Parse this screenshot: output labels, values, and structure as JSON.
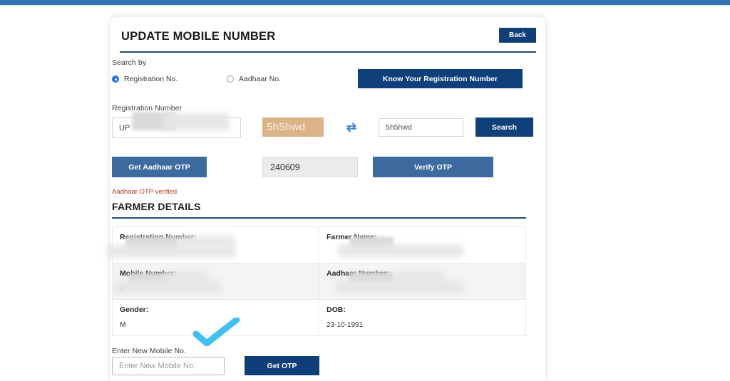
{
  "theme": {
    "accent_bar": "#3273b8",
    "primary_dark": "#10407a",
    "primary_muted": "#3d6ba0",
    "rule": "#1d4e7e",
    "error_text": "#c0392b",
    "captcha_bg": "#dcb387",
    "annotation": "#3fc0f0"
  },
  "header": {
    "title": "UPDATE MOBILE NUMBER",
    "back_label": "Back"
  },
  "search_by": {
    "label": "Search by",
    "options": [
      {
        "label": "Registration No.",
        "selected": true
      },
      {
        "label": "Aadhaar No.",
        "selected": false
      }
    ],
    "know_registration_label": "Know Your Registration Number"
  },
  "registration": {
    "label": "Registration Number",
    "value": "UP",
    "captcha_text": "5h5hwd",
    "refresh_icon": "refresh-icon",
    "captcha_input_value": "5h5hwd",
    "search_label": "Search"
  },
  "otp": {
    "get_aadhaar_otp_label": "Get Aadhaar OTP",
    "otp_value": "240609",
    "verify_label": "Verify OTP",
    "status": "Aadhaar OTP verified"
  },
  "farmer_details": {
    "heading": "FARMER DETAILS",
    "rows": [
      {
        "striped": false,
        "cells": [
          {
            "label": "Registration Number:",
            "value": "",
            "redacted": true
          },
          {
            "label": "Farmer Name:",
            "value": "",
            "redacted": true
          }
        ]
      },
      {
        "striped": true,
        "cells": [
          {
            "label": "Mobile Number:",
            "value": "9",
            "redacted": true
          },
          {
            "label": "Aadhaar Number:",
            "value": "",
            "redacted": true
          }
        ]
      },
      {
        "striped": false,
        "cells": [
          {
            "label": "Gender:",
            "value": "M",
            "redacted": false
          },
          {
            "label": "DOB:",
            "value": "23-10-1991",
            "redacted": false
          }
        ]
      }
    ]
  },
  "new_mobile": {
    "label": "Enter New Mobile No.",
    "placeholder": "Enter New Mobile No.",
    "value": "",
    "get_otp_label": "Get OTP"
  },
  "annotations": {
    "checkmark": "checkmark-annotation"
  }
}
